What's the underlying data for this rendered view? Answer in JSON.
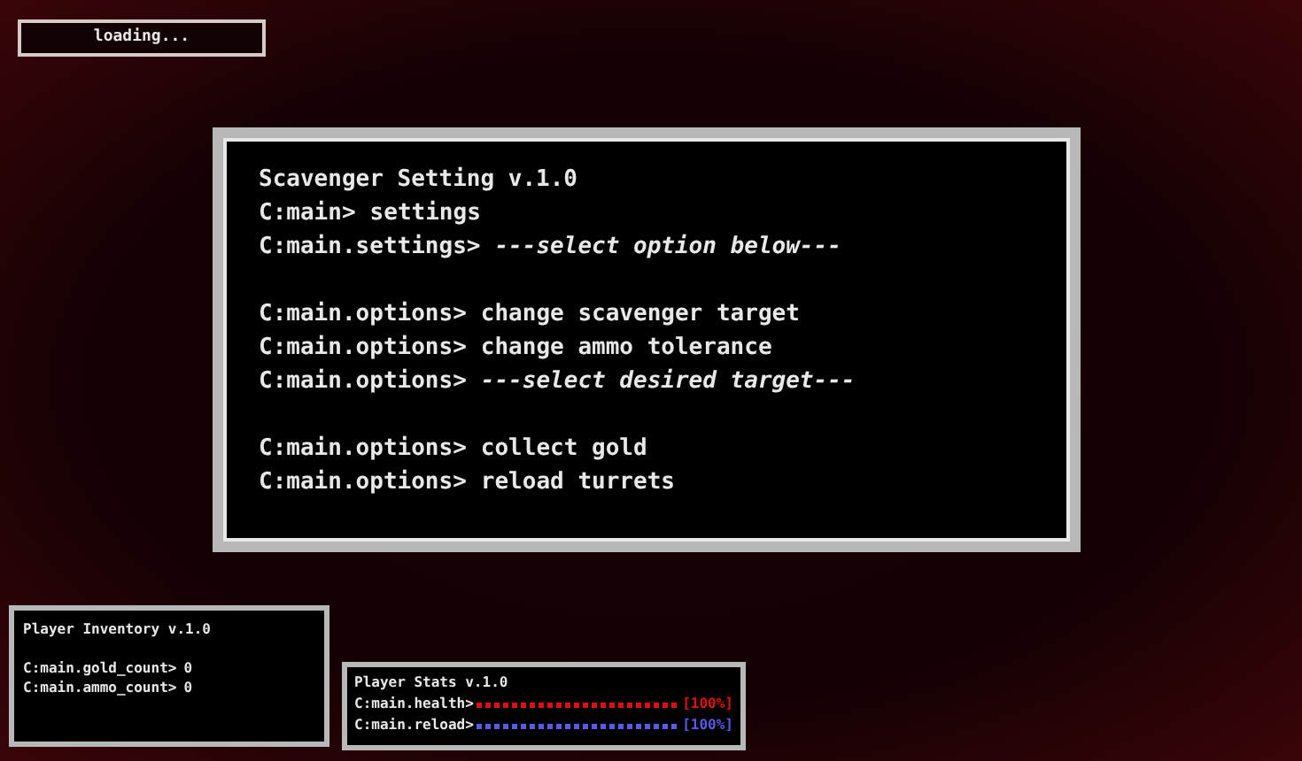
{
  "loading": {
    "label": "loading..."
  },
  "terminal": {
    "title": "Scavenger Setting v.1.0",
    "groups": [
      {
        "lines": [
          {
            "prompt": "C:main>",
            "command": "settings",
            "italic": false
          },
          {
            "prompt": "C:main.settings>",
            "command": "---select option below---",
            "italic": true
          }
        ]
      },
      {
        "lines": [
          {
            "prompt": "C:main.options>",
            "command": "change scavenger target",
            "italic": false
          },
          {
            "prompt": "C:main.options>",
            "command": "change ammo tolerance",
            "italic": false
          },
          {
            "prompt": "C:main.options>",
            "command": "---select desired target---",
            "italic": true
          }
        ]
      },
      {
        "lines": [
          {
            "prompt": "C:main.options>",
            "command": "collect gold",
            "italic": false
          },
          {
            "prompt": "C:main.options>",
            "command": "reload turrets",
            "italic": false
          }
        ]
      }
    ]
  },
  "inventory": {
    "title": "Player Inventory v.1.0",
    "lines": [
      {
        "prompt": "C:main.gold_count>",
        "value": "0"
      },
      {
        "prompt": "C:main.ammo_count>",
        "value": "0"
      }
    ]
  },
  "stats": {
    "title": "Player Stats v.1.0",
    "bars": [
      {
        "prompt": "C:main.health>",
        "reading": "[100%]",
        "color": "#e01010"
      },
      {
        "prompt": "C:main.reload>",
        "reading": "[100%]",
        "color": "#5a5ae6"
      }
    ]
  }
}
